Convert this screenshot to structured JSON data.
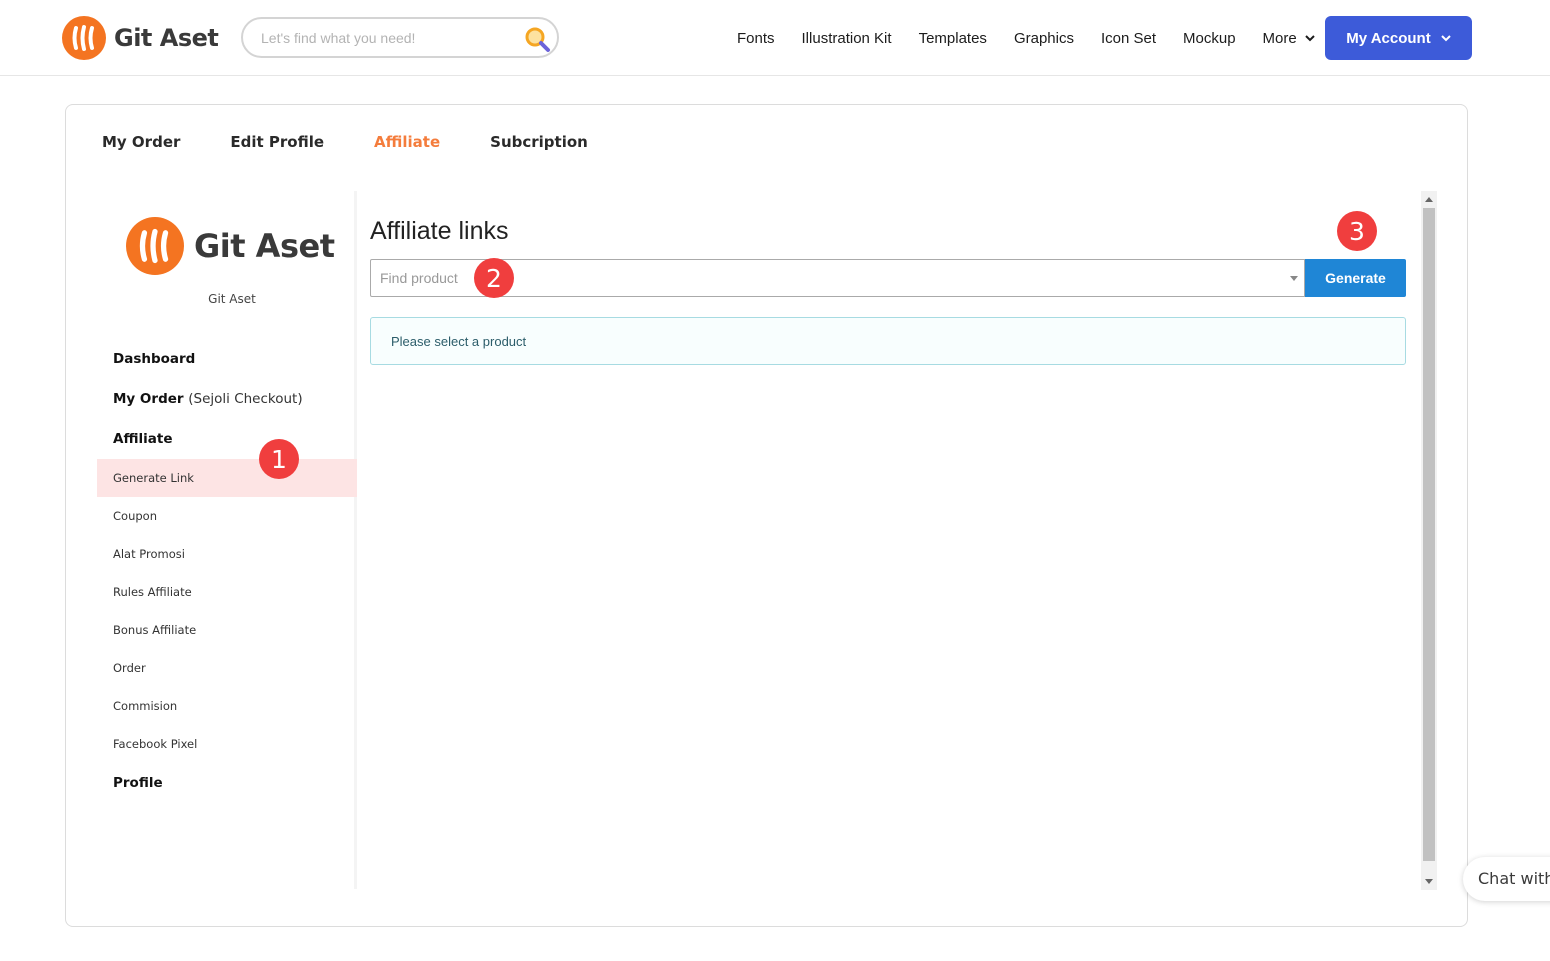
{
  "header": {
    "brand": "Git Aset",
    "search": {
      "placeholder": "Let's find what you need!",
      "value": ""
    },
    "nav": [
      "Fonts",
      "Illustration Kit",
      "Templates",
      "Graphics",
      "Icon Set",
      "Mockup"
    ],
    "more_label": "More",
    "account_label": "My Account"
  },
  "tabs": [
    {
      "label": "My Order",
      "active": false
    },
    {
      "label": "Edit Profile",
      "active": false
    },
    {
      "label": "Affiliate",
      "active": true
    },
    {
      "label": "Subcription",
      "active": false
    }
  ],
  "sidebar": {
    "brand": "Git Aset",
    "username": "Git Aset",
    "dashboard": "Dashboard",
    "my_order": "My Order",
    "my_order_sub": "(Sejoli Checkout)",
    "affiliate": "Affiliate",
    "affiliate_items": [
      {
        "label": "Generate Link",
        "active": true
      },
      {
        "label": "Coupon",
        "active": false
      },
      {
        "label": "Alat Promosi",
        "active": false
      },
      {
        "label": "Rules Affiliate",
        "active": false
      },
      {
        "label": "Bonus Affiliate",
        "active": false
      },
      {
        "label": "Order",
        "active": false
      },
      {
        "label": "Commision",
        "active": false
      },
      {
        "label": "Facebook Pixel",
        "active": false
      }
    ],
    "profile": "Profile"
  },
  "content": {
    "title": "Affiliate links",
    "product_select_placeholder": "Find product",
    "generate_label": "Generate",
    "notice": "Please select a product"
  },
  "markers": [
    "1",
    "2",
    "3"
  ],
  "chat_label": "Chat with",
  "colors": {
    "brand_orange": "#f47421",
    "active_tab": "#f47c3c",
    "account_button": "#3d5bd9",
    "generate_button": "#1f86d6",
    "marker_red": "#f03e3e",
    "active_menu_bg": "#fde4e4"
  }
}
